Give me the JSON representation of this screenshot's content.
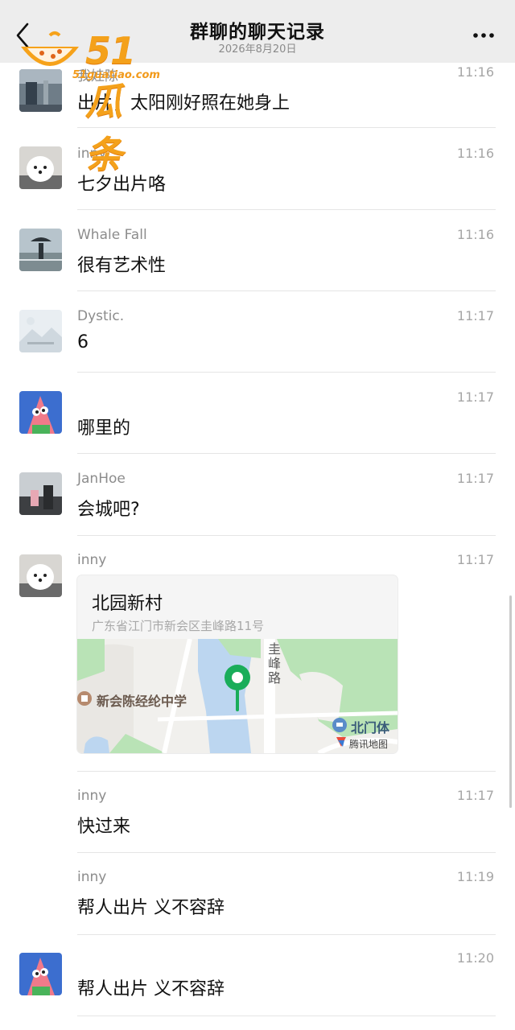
{
  "header": {
    "title": "群聊的聊天记录",
    "date": "2026年8月20日"
  },
  "watermark": {
    "brand": "51瓜条",
    "url": "51guatiao.com"
  },
  "messages": [
    {
      "name": "我娃陈",
      "time": "11:16",
      "text": "出片，太阳刚好照在她身上"
    },
    {
      "name": "inny",
      "time": "11:16",
      "text": "七夕出片咯"
    },
    {
      "name": "Whale Fall",
      "time": "11:16",
      "text": "很有艺术性"
    },
    {
      "name": "Dystic.",
      "time": "11:17",
      "text": "6"
    },
    {
      "name": "",
      "time": "11:17",
      "text": "哪里的"
    },
    {
      "name": "JanHoe",
      "time": "11:17",
      "text": "会城吧?"
    },
    {
      "name": "inny",
      "time": "11:17",
      "text": ""
    },
    {
      "name": "inny",
      "time": "11:17",
      "text": "快过来"
    },
    {
      "name": "inny",
      "time": "11:19",
      "text": "帮人出片 义不容辞"
    },
    {
      "name": "",
      "time": "11:20",
      "text": "帮人出片 义不容辞"
    }
  ],
  "location": {
    "title": "北园新村",
    "address": "广东省江门市新会区圭峰路11号",
    "school_label": "新会陈经纶中学",
    "road_label": "圭峰路",
    "poi_label": "北门体",
    "map_brand": "腾讯地图"
  },
  "colors": {
    "header_bg": "#ededed",
    "pin": "#1aad5a",
    "water": "#bcd6f0",
    "park": "#b9e3b6"
  }
}
